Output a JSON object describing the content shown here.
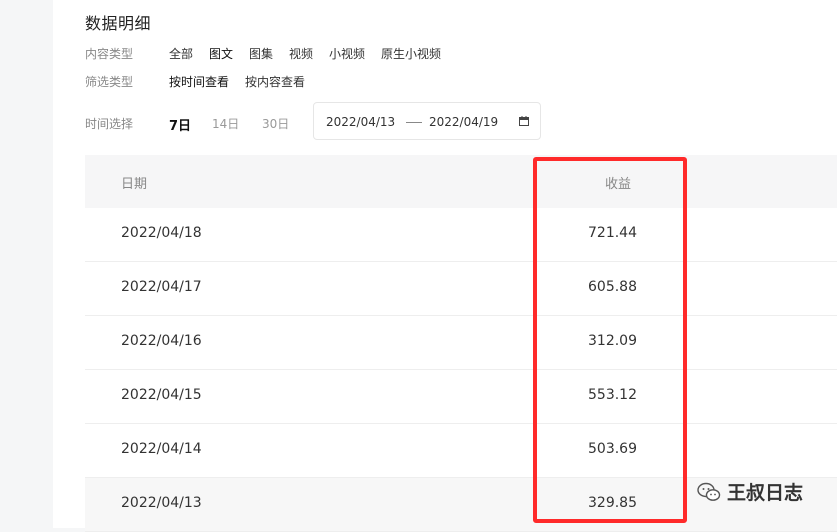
{
  "header": {
    "title": "数据明细"
  },
  "filters": {
    "content_type_label": "内容类型",
    "content_types": [
      "全部",
      "图文",
      "图集",
      "视频",
      "小视频",
      "原生小视频"
    ],
    "filter_type_label": "筛选类型",
    "filter_types": [
      "按时间查看",
      "按内容查看"
    ],
    "time_label": "时间选择",
    "time_options": [
      "7日",
      "14日",
      "30日"
    ],
    "date_start": "2022/04/13",
    "date_end": "2022/04/19"
  },
  "table": {
    "headers": [
      "日期",
      "收益"
    ],
    "rows": [
      {
        "date": "2022/04/18",
        "value": "721.44"
      },
      {
        "date": "2022/04/17",
        "value": "605.88"
      },
      {
        "date": "2022/04/16",
        "value": "312.09"
      },
      {
        "date": "2022/04/15",
        "value": "553.12"
      },
      {
        "date": "2022/04/14",
        "value": "503.69"
      },
      {
        "date": "2022/04/13",
        "value": "329.85"
      }
    ]
  },
  "watermark": {
    "text": "王叔日志",
    "icon": "wechat-icon"
  },
  "colors": {
    "highlight": "#ff2a2a"
  }
}
